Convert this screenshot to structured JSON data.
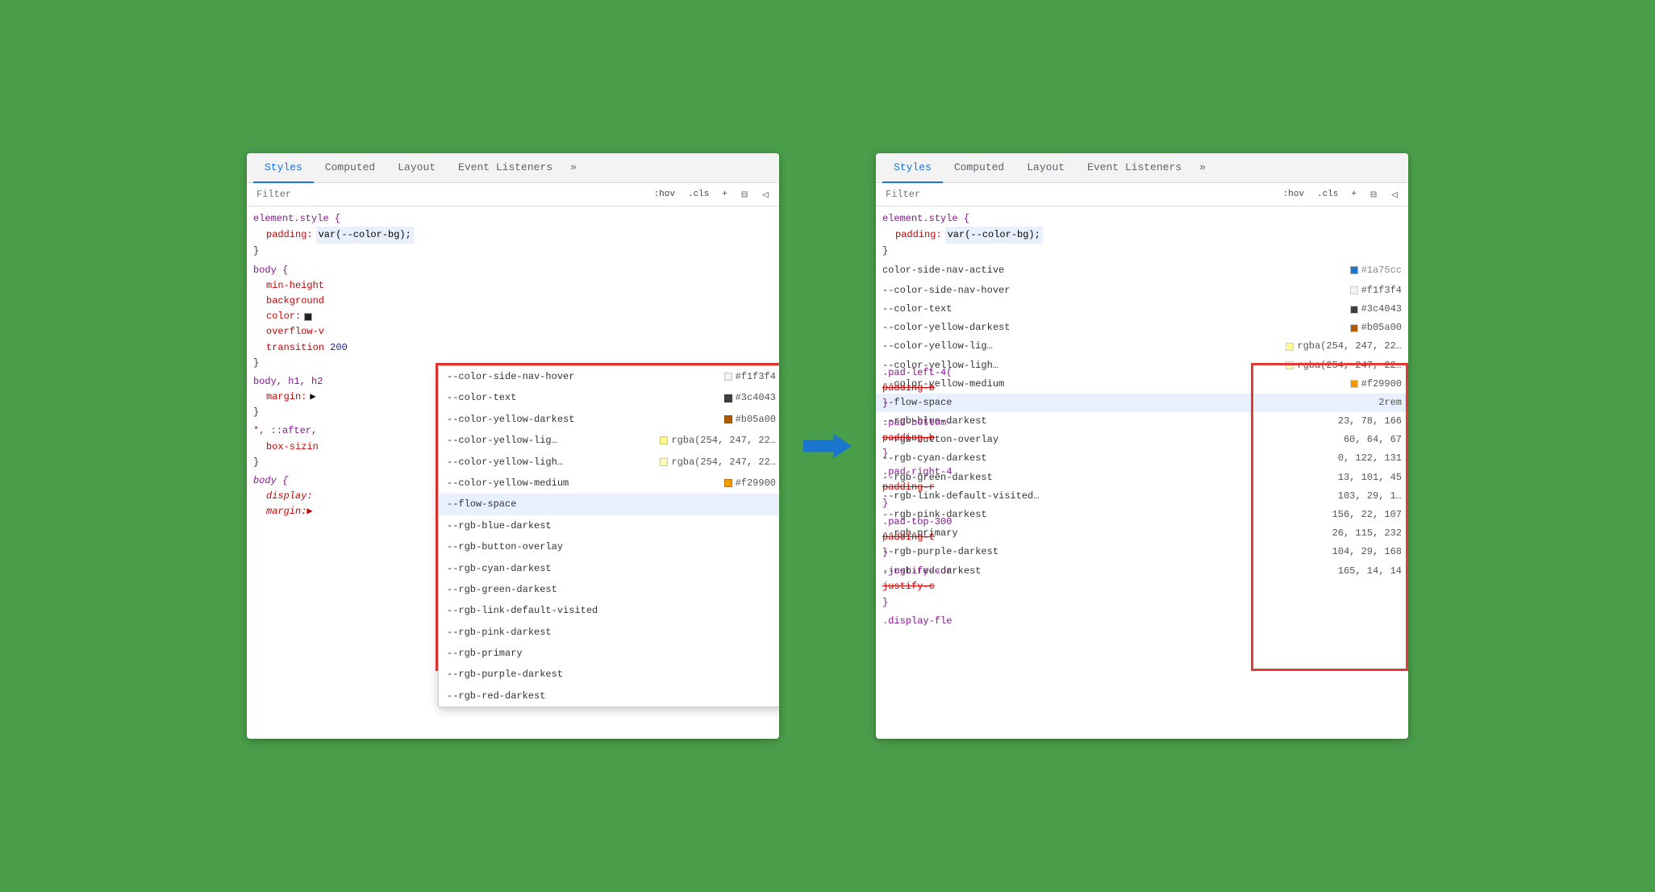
{
  "panel_left": {
    "tabs": [
      {
        "label": "Styles",
        "active": true
      },
      {
        "label": "Computed",
        "active": false
      },
      {
        "label": "Layout",
        "active": false
      },
      {
        "label": "Event Listeners",
        "active": false
      },
      {
        "label": "»",
        "active": false
      }
    ],
    "filter_placeholder": "Filter",
    "toolbar_buttons": [
      ":hov",
      ".cls",
      "+"
    ],
    "css_rules": [
      {
        "selector": "element.style {",
        "properties": [
          {
            "name": "padding:",
            "value": "var(--color-bg);"
          }
        ],
        "close": "}"
      },
      {
        "selector": "body {",
        "properties": [
          {
            "name": "min-height",
            "value": ""
          },
          {
            "name": "background",
            "value": ""
          },
          {
            "name": "color:",
            "value": "■"
          },
          {
            "name": "overflow-v",
            "value": ""
          },
          {
            "name": "transition",
            "value": "200"
          }
        ],
        "close": "}"
      },
      {
        "selector": "body, h1, h2",
        "properties": [
          {
            "name": "margin:",
            "value": "▶"
          }
        ],
        "close": "}"
      },
      {
        "selector": "*, ::after,",
        "properties": [
          {
            "name": "box-sizin",
            "value": ""
          }
        ],
        "close": "}"
      },
      {
        "selector": "body {",
        "italic": true,
        "properties": [
          {
            "name": "display:",
            "value": "",
            "italic": true
          },
          {
            "name": "margin:▶",
            "value": "",
            "italic": true
          }
        ],
        "close": "}"
      }
    ],
    "autocomplete": {
      "items": [
        {
          "name": "--color-side-nav-hover",
          "swatch": "#f1f3f4",
          "swatch_color": "#f1f3f4",
          "value": "#f1f3f4"
        },
        {
          "name": "--color-text",
          "swatch": "#3c4043",
          "swatch_color": "#3c4043",
          "value": "#3c4043"
        },
        {
          "name": "--color-yellow-darkest",
          "swatch": "#b05a00",
          "swatch_color": "#b05a00",
          "value": "#b05a00"
        },
        {
          "name": "--color-yellow-lig…",
          "swatch_color": "rgba(254,247,22,0.5)",
          "value": "rgba(254, 247, 22…"
        },
        {
          "name": "--color-yellow-ligh…",
          "swatch_color": "rgba(254,247,22,0.3)",
          "value": "rgba(254, 247, 22…"
        },
        {
          "name": "--color-yellow-medium",
          "swatch_color": "#f29900",
          "value": "#f29900"
        },
        {
          "name": "--flow-space",
          "value": "",
          "highlighted": true
        },
        {
          "name": "--rgb-blue-darkest",
          "value": ""
        },
        {
          "name": "--rgb-button-overlay",
          "value": ""
        },
        {
          "name": "--rgb-cyan-darkest",
          "value": ""
        },
        {
          "name": "--rgb-green-darkest",
          "value": ""
        },
        {
          "name": "--rgb-link-default-visited",
          "value": ""
        },
        {
          "name": "--rgb-pink-darkest",
          "value": ""
        },
        {
          "name": "--rgb-primary",
          "value": ""
        },
        {
          "name": "--rgb-purple-darkest",
          "value": ""
        },
        {
          "name": "--rgb-red-darkest",
          "value": ""
        }
      ]
    }
  },
  "panel_right": {
    "tabs": [
      {
        "label": "Styles",
        "active": true
      },
      {
        "label": "Computed",
        "active": false
      },
      {
        "label": "Layout",
        "active": false
      },
      {
        "label": "Event Listeners",
        "active": false
      },
      {
        "label": "»",
        "active": false
      }
    ],
    "filter_placeholder": "Filter",
    "toolbar_buttons": [
      ":hov",
      ".cls",
      "+"
    ],
    "top_rules": [
      {
        "selector": "element.style {",
        "properties": [
          {
            "name": "padding:",
            "value": "var(--color-bg);"
          }
        ],
        "close": "}"
      }
    ],
    "partial_rules": [
      {
        "selector_partial": "color-side-nav-active",
        "swatch_color": "#1a75cc"
      },
      {
        "selector": ".pad-left-4(",
        "property": "padding-b",
        "strikethrough": true
      },
      {
        "selector": ".pad-bottom-",
        "property": "padding-b",
        "strikethrough": true
      },
      {
        "selector": ".pad-right-4",
        "property": "padding-r",
        "strikethrough": true
      },
      {
        "selector": ".pad-top-300",
        "property": "padding-t",
        "strikethrough": true
      },
      {
        "selector": ".justify-cor",
        "property": "justify-c",
        "strikethrough": true
      },
      {
        "selector": ".display-fle",
        "property": ""
      }
    ],
    "css_vars": [
      {
        "name": "--color-side-nav-hover",
        "swatch_color": "#f1f3f4",
        "value": "#f1f3f4"
      },
      {
        "name": "--color-text",
        "swatch_color": "#3c4043",
        "value": "#3c4043"
      },
      {
        "name": "--color-yellow-darkest",
        "swatch_color": "#b05a00",
        "value": "#b05a00"
      },
      {
        "name": "--color-yellow-lig…",
        "swatch_color": "rgba(254,247,22,0.5)",
        "value": "rgba(254, 247, 22…"
      },
      {
        "name": "--color-yellow-ligh…",
        "swatch_color": "rgba(254,247,22,0.3)",
        "value": "rgba(254, 247, 22…"
      },
      {
        "name": "--color-yellow-medium",
        "swatch_color": "#f29900",
        "value": "#f29900"
      },
      {
        "name": "--flow-space",
        "value": "2rem",
        "highlighted": true
      },
      {
        "name": "--rgb-blue-darkest",
        "value": "23, 78, 166"
      },
      {
        "name": "--rgb-button-overlay",
        "value": "60, 64, 67"
      },
      {
        "name": "--rgb-cyan-darkest",
        "value": "0, 122, 131"
      },
      {
        "name": "--rgb-green-darkest",
        "value": "13, 101, 45"
      },
      {
        "name": "--rgb-link-default-visited…",
        "value": "103, 29, 1…"
      },
      {
        "name": "--rgb-pink-darkest",
        "value": "156, 22, 107"
      },
      {
        "name": "--rgb-primary",
        "value": "26, 115, 232"
      },
      {
        "name": "--rgb-purple-darkest",
        "value": "104, 29, 168"
      },
      {
        "name": "--rgb-red-darkest",
        "value": "165, 14, 14"
      }
    ]
  },
  "arrow": {
    "color": "#1a75cc"
  }
}
